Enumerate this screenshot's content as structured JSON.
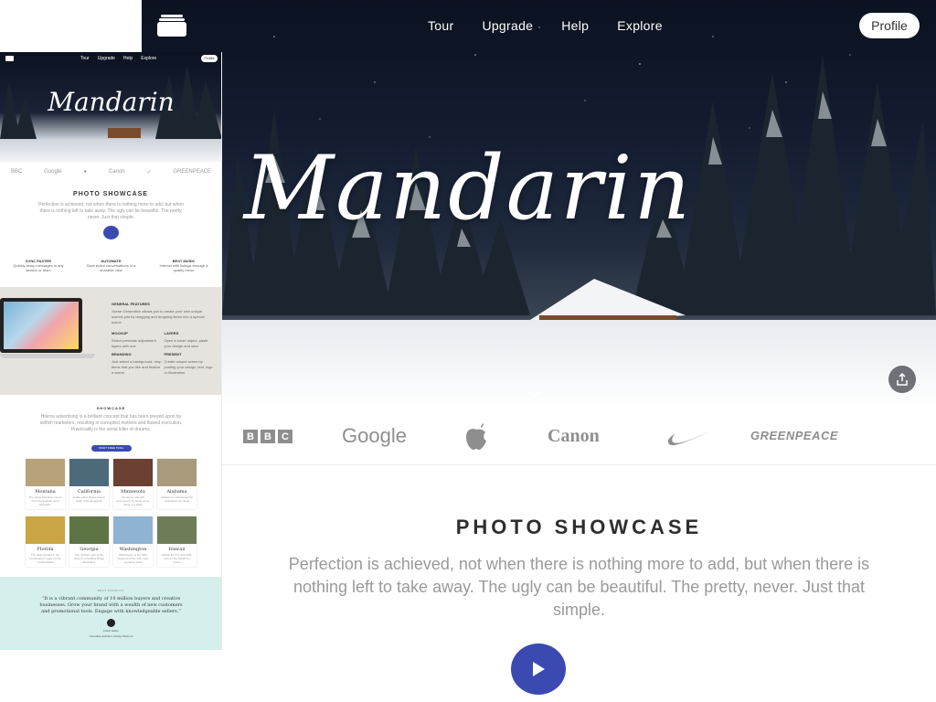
{
  "nav": {
    "items": [
      "Tour",
      "Upgrade",
      "Help",
      "Explore"
    ],
    "profile_label": "Profile"
  },
  "hero": {
    "logo_text": "Mandarin"
  },
  "brands": {
    "bbc": [
      "B",
      "B",
      "C"
    ],
    "google": "Google",
    "canon": "Canon",
    "greenpeace": "GREENPEACE"
  },
  "showcase": {
    "title": "PHOTO SHOWCASE",
    "text": "Perfection is achieved, not when there is nothing more to add, but when there is nothing left to take away. The ugly can be beautiful. The pretty, never. Just that simple."
  },
  "thumbnail": {
    "nav": [
      "Tour",
      "Upgrade",
      "Help",
      "Explore"
    ],
    "profile_label": "Profile",
    "logo_text": "Mandarin",
    "brands": [
      "BBC",
      "Google",
      "",
      "Canon",
      "",
      "GREENPEACE"
    ],
    "section_title": "PHOTO SHOWCASE",
    "section_text": "Perfection is achieved, not when there is nothing more to add, but when there is nothing left to take away. The ugly can be beautiful. The pretty, never. Just that simple.",
    "features": [
      {
        "title": "SYNC FASTER",
        "text": "Quickly setup messages in any section or team"
      },
      {
        "title": "AUTOMATE",
        "text": "Save entire conversations in a sharable view"
      },
      {
        "title": "BEST MUSIC",
        "text": "Interact with listings through a quality menu"
      }
    ],
    "general_features": {
      "title": "GENERAL FEATURES",
      "text": "Scene Generation allows you to create your own unique scenes just by dragging and dropping items into a special scene.",
      "items": [
        {
          "title": "MOCKUP",
          "text": "Select premade adjustment layers with one"
        },
        {
          "title": "LAYERS",
          "text": "Open a smart object, paste your design and save"
        },
        {
          "title": "BRANDING",
          "text": "Just select a background, drop items that you like and finalize a scene."
        },
        {
          "title": "PRESENT",
          "text": "Create unique scene by posting your design, text, logo or illustration."
        }
      ]
    },
    "showcase2": {
      "title": "SHOWCASE",
      "text": "Hilensi advertising is a brilliant concept that has been preyed upon by selfish marketers, resulting in corrupted motives and flawed execution. Practicality is the serial killer of dreams.",
      "button": "START FREE TRIAL"
    },
    "cards": [
      {
        "name": "Montana",
        "desc": "The name Montana comes from the Spanish word Montaña.",
        "color": "#b8a27a"
      },
      {
        "name": "California",
        "desc": "Unlike other places known much CSS geography",
        "color": "#4d6a7a"
      },
      {
        "name": "Minnesota",
        "desc": "Someone else will accompany by being some fame in a state",
        "color": "#6b3f31"
      },
      {
        "name": "Alabama",
        "desc": "Alabama is nicknamed the Yellowhammer State",
        "color": "#a89a7a"
      },
      {
        "name": "Florida",
        "desc": "The state located in the southeastern region of the United States",
        "color": "#c9a545"
      },
      {
        "name": "Georgia",
        "desc": "The northern part of the state is in the Blue Ridge Mountains",
        "color": "#5d7444"
      },
      {
        "name": "Washington",
        "desc": "Washington is the 18th largest and the 13th most populous state",
        "color": "#8eb3d3"
      },
      {
        "name": "Hawaii",
        "desc": "Hawaii the 5 th and 13th, most of the Pacific for prizes",
        "color": "#6e7d58"
      }
    ],
    "quote": {
      "label": "BEST PRODUCT",
      "text": "“It is a vibrant community of 10 million buyers and creative businesses. Grow your brand with a wealth of new customers and promotional tools. Engage with knowledgeable sellers.”",
      "name": "Frank Sellen",
      "role": "Canadian architect, Ashley Partners"
    }
  },
  "colors": {
    "accent": "#3a4ab0",
    "quote_bg": "#d4efec",
    "feature_bg": "#e6e3de",
    "brand_gray": "#8e8e8e"
  },
  "icons": [
    "menu-stack-icon",
    "share-icon",
    "chevron-down-icon",
    "play-icon",
    "apple-icon",
    "nike-icon"
  ]
}
